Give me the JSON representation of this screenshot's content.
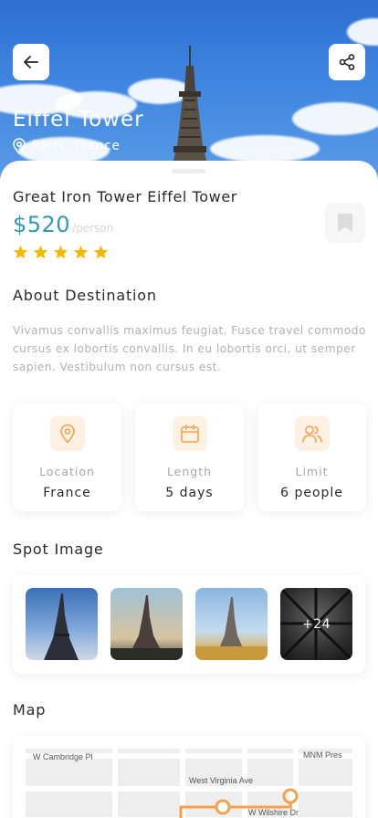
{
  "hero": {
    "title": "Eiffel Tower",
    "location": "Paris, France",
    "back_icon": "arrow-left-icon",
    "share_icon": "share-icon"
  },
  "trip": {
    "name": "Great Iron Tower Eiffel Tower",
    "price": "$520",
    "price_unit": "/person",
    "rating": 5,
    "rating_max": 5,
    "bookmark_icon": "bookmark-icon"
  },
  "about": {
    "title": "About Destination",
    "description": "Vivamus convallis maximus feugiat. Fusce travel commodo cursus ex lobortis convallis. In eu lobortis orci, ut semper sapien. Vestibulum non cursus est."
  },
  "info": [
    {
      "icon": "map-pin-icon",
      "label": "Location",
      "value": "France"
    },
    {
      "icon": "calendar-icon",
      "label": "Length",
      "value": "5 days"
    },
    {
      "icon": "users-icon",
      "label": "Limit",
      "value": "6 people"
    }
  ],
  "spots": {
    "title": "Spot Image",
    "more_label": "+24"
  },
  "map": {
    "title": "Map",
    "streets": [
      "W Cambridge Pl",
      "MNM Pres",
      "West Virginia Ave",
      "W Wilshire Dr"
    ]
  },
  "colors": {
    "accent": "#2e9bb4",
    "star": "#f5b800",
    "icon_orange": "#f5a14a",
    "icon_bg": "#fdf1e3"
  }
}
